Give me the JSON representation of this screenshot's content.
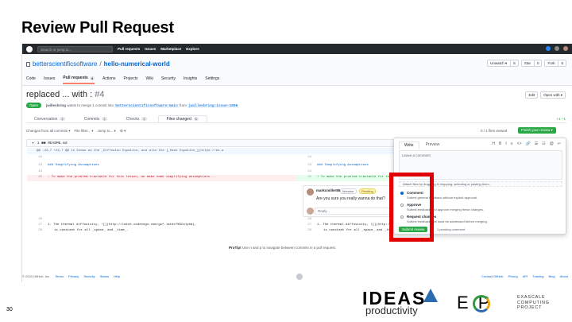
{
  "slide": {
    "title": "Review Pull Request",
    "page_number": "30"
  },
  "header": {
    "search_placeholder": "Search or jump to...",
    "nav": [
      "Pull requests",
      "Issues",
      "Marketplace",
      "Explore"
    ]
  },
  "repo": {
    "owner": "betterscientificsoftware",
    "separator": "/",
    "name": "hello-numerical-world",
    "actions": [
      {
        "label": "Unwatch ▾",
        "count": "6"
      },
      {
        "label": "Star",
        "count": "0"
      },
      {
        "label": "Fork",
        "count": "5"
      }
    ],
    "tabs": [
      {
        "label": "Code",
        "count": ""
      },
      {
        "label": "Issues",
        "count": ""
      },
      {
        "label": "Pull requests",
        "count": "4"
      },
      {
        "label": "Actions",
        "count": ""
      },
      {
        "label": "Projects",
        "count": ""
      },
      {
        "label": "Wiki",
        "count": ""
      },
      {
        "label": "Security",
        "count": ""
      },
      {
        "label": "Insights",
        "count": ""
      },
      {
        "label": "Settings",
        "count": ""
      }
    ]
  },
  "pr": {
    "title": "replaced ... with :",
    "number": "#4",
    "edit_label": "Edit",
    "open_with_label": "Open with ▾",
    "state": "Open",
    "author": "jwillenbring",
    "meta_text": "wants to merge 1 commit into",
    "base_branch": "betterscientificsoftware:main",
    "from_text": "from",
    "head_branch": "jwillenbring:issue-1000",
    "tabs": [
      {
        "label": "Conversation",
        "count": "1"
      },
      {
        "label": "Commits",
        "count": "1"
      },
      {
        "label": "Checks",
        "count": "1"
      },
      {
        "label": "Files changed",
        "count": "1"
      }
    ],
    "diffstat": "+1 −1"
  },
  "files": {
    "toolbar": [
      "Changes from all commits ▾",
      "File filter... ▾",
      "Jump to... ▾",
      "⚙ ▾"
    ],
    "viewed": "0 / 1 files viewed",
    "finish_label": "Finish your review ▾",
    "file_header": "1  ■■  README.md",
    "hunk": "@@ -22,7 +22,7 @@ is known as the _Diffusion Equation, and also the [_Heat Equation_](https://en.w"
  },
  "diff": {
    "rows": [
      {
        "l_num": "22",
        "l_code": "",
        "r_num": "22",
        "r_code": "",
        "type": "ctx"
      },
      {
        "l_num": "23",
        "l_code": "### Simplifying Assumptions",
        "r_num": "23",
        "r_code": "### Simplifying Assumptions",
        "type": "ctx"
      },
      {
        "l_num": "24",
        "l_code": "",
        "r_num": "24",
        "r_code": "",
        "type": "ctx"
      },
      {
        "l_num": "25",
        "l_code": "- To make the problem tractable for this lesson, we make some simplifying assumptions...",
        "r_num": "25",
        "r_code": "+ To make the problem tractable for this le",
        "type": "chg"
      }
    ],
    "rows_after": [
      {
        "l_num": "26",
        "l_code": "",
        "r_num": "26",
        "r_code": "",
        "type": "ctx"
      },
      {
        "l_num": "27",
        "l_code": "1. The thermal diffusivity, ![](http://latex.codecogs.com/gif.latex?%5Calpha),",
        "r_num": "27",
        "r_code": "1. The thermal diffusivity, ![](http://late",
        "type": "ctx"
      },
      {
        "l_num": "28",
        "l_code": "is constant for all _space_ and _time_.",
        "r_num": "28",
        "r_code": "is constant for all _space_ and _tim",
        "type": "ctx"
      }
    ]
  },
  "comment": {
    "author": "markcmiller86",
    "role": "Member",
    "status": "Pending",
    "text": "Are you sure you really wanna do that?",
    "reply_placeholder": "Reply..."
  },
  "review": {
    "tabs": [
      "Write",
      "Preview"
    ],
    "tools": [
      "H",
      "B",
      "I",
      "≡",
      "<>",
      "🔗",
      "☰",
      "☷",
      "@",
      "↩"
    ],
    "placeholder": "Leave a comment",
    "attach": "Attach files by dragging & dropping, selecting or pasting them.",
    "options": [
      {
        "name": "Comment",
        "desc": "Submit general feedback without explicit approval.",
        "selected": true
      },
      {
        "name": "Approve",
        "desc": "Submit feedback and approve merging these changes.",
        "selected": false
      },
      {
        "name": "Request changes",
        "desc": "Submit feedback that must be addressed before merging.",
        "selected": false
      }
    ],
    "submit_label": "Submit review",
    "pending_text": "1 pending comment"
  },
  "protip": {
    "prefix": "ProTip!",
    "text": "Use n and p to navigate between commits in a pull request."
  },
  "footer": {
    "copyright": "© 2020 GitHub, Inc.",
    "left_links": [
      "Terms",
      "Privacy",
      "Security",
      "Status",
      "Help"
    ],
    "right_links": [
      "Contact GitHub",
      "Pricing",
      "API",
      "Training",
      "Blog",
      "About"
    ]
  },
  "logos": {
    "ideas_word": "IDEAS",
    "ideas_sub": "productivity",
    "ecp_word": "E  P",
    "ecp_sub": [
      "EXASCALE",
      "COMPUTING",
      "PROJECT"
    ]
  },
  "colors": {
    "highlight": "#e00000",
    "primary_green": "#28a745",
    "link_blue": "#0366d6"
  }
}
